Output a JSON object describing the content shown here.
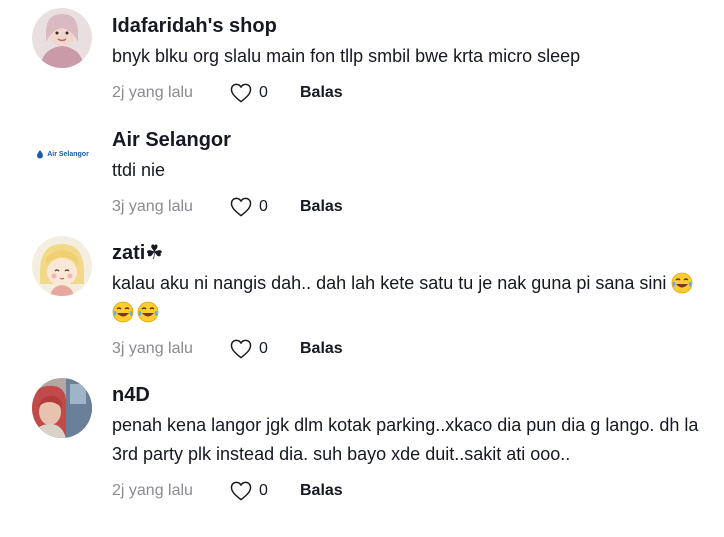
{
  "comments": [
    {
      "username": "Idafaridah's shop",
      "text": "bnyk blku org slalu main fon tllp smbil bwe krta micro sleep",
      "time": "2j yang lalu",
      "likes": "0",
      "reply_label": "Balas"
    },
    {
      "username": "Air Selangor",
      "avatar_text": "Air Selangor",
      "text": "ttdi nie",
      "time": "3j yang lalu",
      "likes": "0",
      "reply_label": "Balas"
    },
    {
      "username": "zati☘",
      "text": "kalau aku ni nangis dah.. dah lah kete satu tu je nak guna pi sana sini",
      "emoji": [
        "face-with-tears-of-joy",
        "face-with-tears-of-joy",
        "face-with-tears-of-joy"
      ],
      "time": "3j yang lalu",
      "likes": "0",
      "reply_label": "Balas"
    },
    {
      "username": "n4D",
      "text": "penah kena langor jgk dlm kotak parking..xkaco dia pun dia g lango. dh la 3rd party plk instead dia. suh bayo xde duit..sakit ati ooo..",
      "time": "2j yang lalu",
      "likes": "0",
      "reply_label": "Balas"
    }
  ],
  "colors": {
    "text": "#161823",
    "muted": "#8a8b91",
    "brand_blue": "#1b5aa6"
  },
  "icons": {
    "like": "heart-outline-icon"
  }
}
